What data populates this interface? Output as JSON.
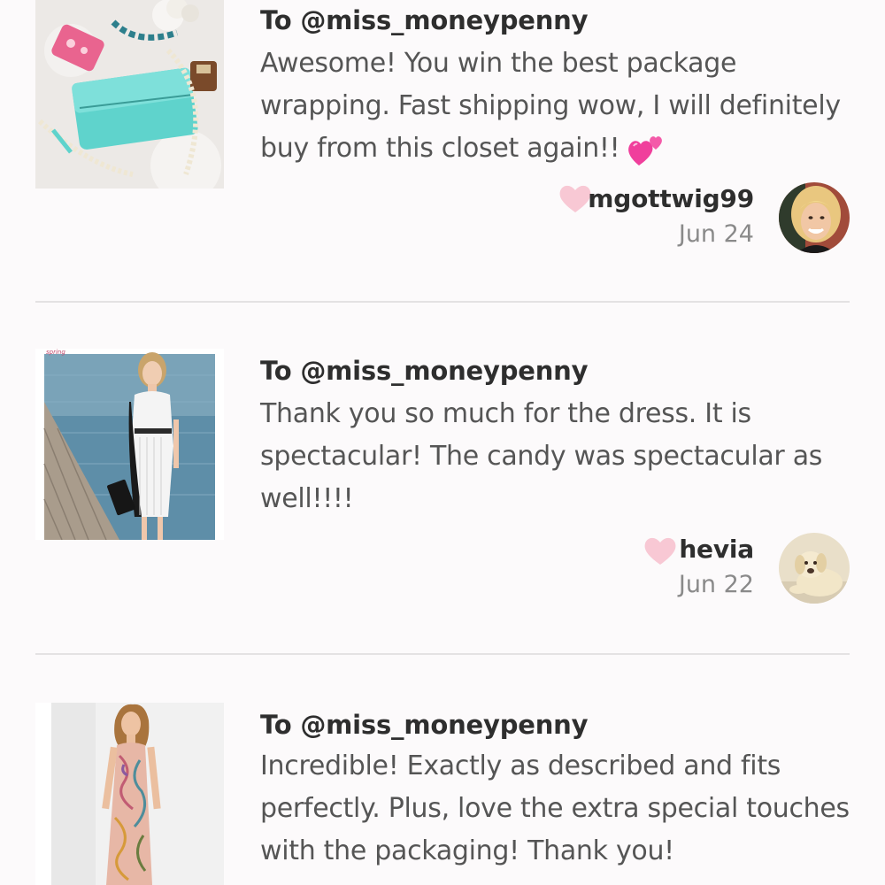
{
  "reviews": [
    {
      "recipient": "To @miss_moneypenny",
      "message": "Awesome! You win the best package wrapping. Fast shipping wow, I will definitely buy from this closet again!!",
      "username": "mgottwig99",
      "date": "Jun 24",
      "item_icon": "turquoise-clutch-photo",
      "avatar_icon": "blonde-woman-avatar"
    },
    {
      "recipient": "To @miss_moneypenny",
      "message": "Thank you so much for the dress. It is spectacular! The candy was spectacular as well!!!!",
      "username": "hevia",
      "date": "Jun 22",
      "item_icon": "white-sheath-dress-photo",
      "avatar_icon": "dog-avatar"
    },
    {
      "recipient": "To @miss_moneypenny",
      "message": "Incredible! Exactly as described and fits perfectly. Plus, love the extra special touches with the packaging! Thank you!",
      "item_icon": "paisley-maxi-dress-photo"
    }
  ],
  "colors": {
    "background": "#fcfafb",
    "like_heart": "#f8c8d4",
    "divider": "#e4e2e3",
    "heading_text": "#2e2e2e",
    "body_text": "#555555",
    "date_text": "#8a8a8a"
  }
}
